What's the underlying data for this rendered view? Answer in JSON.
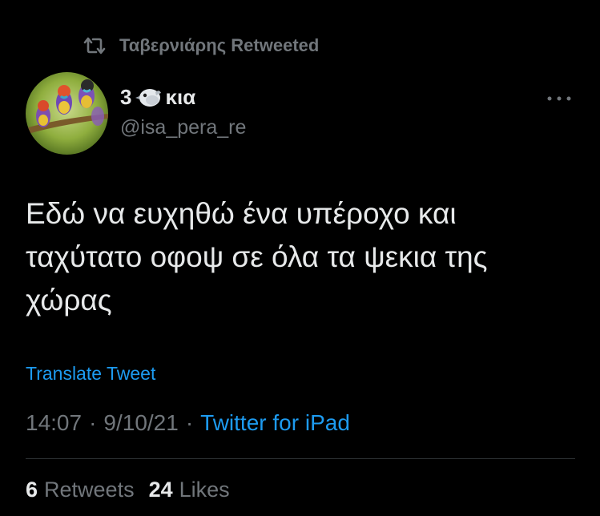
{
  "retweet": {
    "icon": "retweet-icon",
    "label": "Ταβερνιάρης Retweeted"
  },
  "author": {
    "avatar": "avatar-gouldian-finches",
    "name_prefix": "3",
    "name_emoji": "bird-emoji-icon",
    "name_suffix": "κια",
    "handle": "@isa_pera_re"
  },
  "more_icon": "more-horizontal-icon",
  "tweet": {
    "text": "Εδώ να ευχηθώ ένα υπέροχο και\nταχύτατο οφοψ σε όλα τα ψεκια της\nχώρας",
    "translate_label": "Translate Tweet"
  },
  "meta": {
    "time": "14:07",
    "separator": "·",
    "date": "9/10/21",
    "source": "Twitter for iPad"
  },
  "stats": {
    "retweets_count": "6",
    "retweets_label": "Retweets",
    "likes_count": "24",
    "likes_label": "Likes"
  },
  "colors": {
    "background": "#000000",
    "primary_text": "#e7e9ea",
    "secondary_text": "#71767b",
    "link": "#1d9bf0",
    "divider": "#2f3336"
  }
}
